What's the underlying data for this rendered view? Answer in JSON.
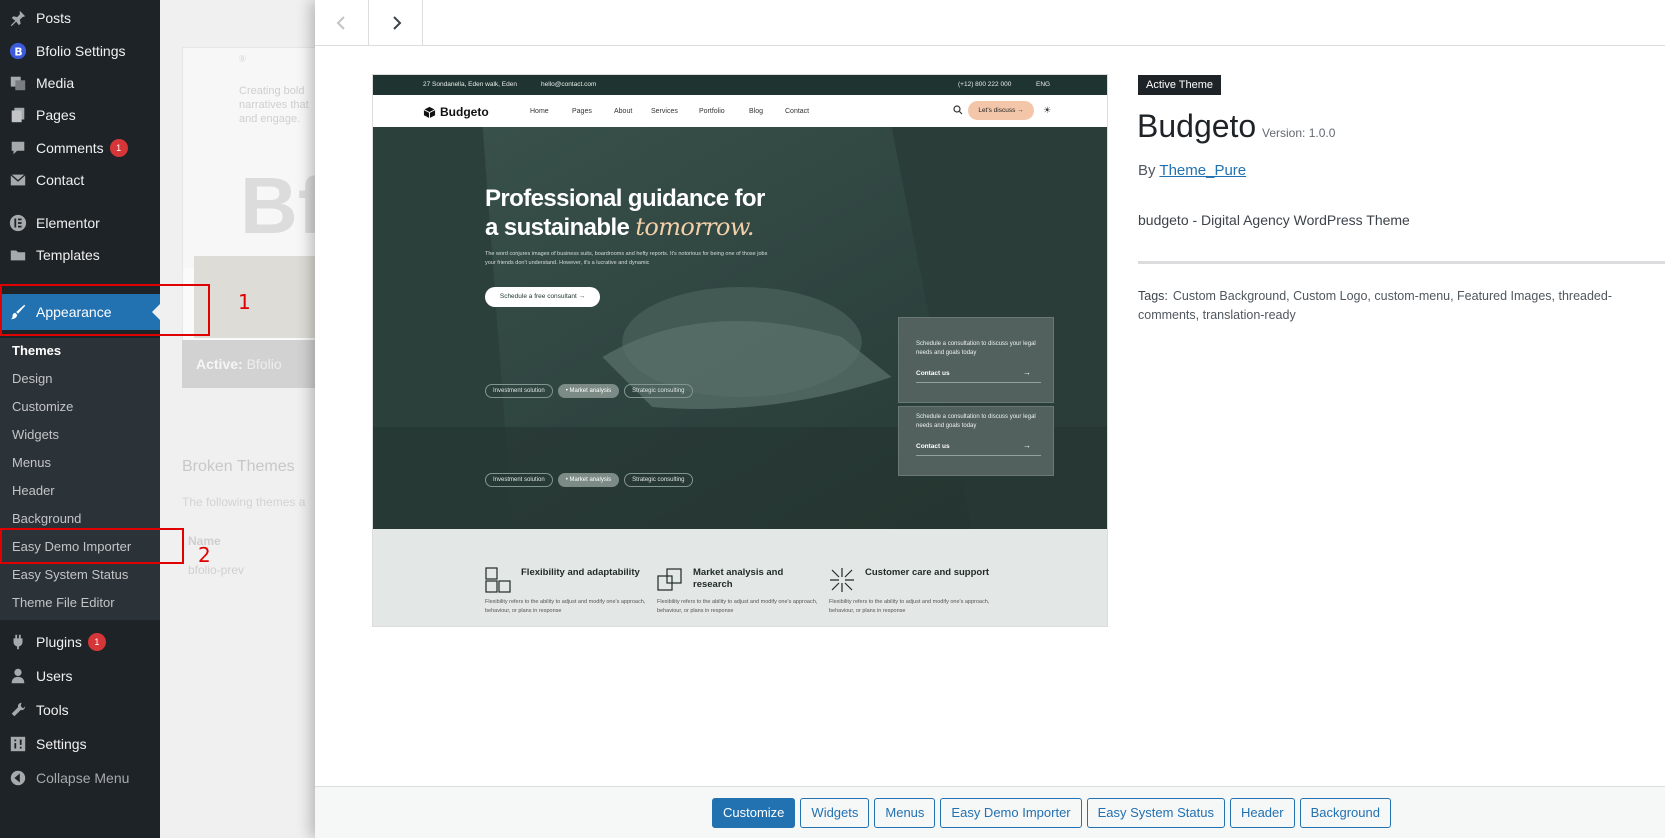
{
  "sidebar": {
    "items": [
      {
        "label": "Posts",
        "icon": "pin-icon"
      },
      {
        "label": "Bfolio Settings",
        "icon": "bfolio-icon"
      },
      {
        "label": "Media",
        "icon": "media-icon"
      },
      {
        "label": "Pages",
        "icon": "pages-icon"
      },
      {
        "label": "Comments",
        "icon": "comment-icon",
        "badge": "1"
      },
      {
        "label": "Contact",
        "icon": "envelope-icon"
      },
      {
        "label": "Elementor",
        "icon": "elementor-icon"
      },
      {
        "label": "Templates",
        "icon": "folder-icon"
      },
      {
        "label": "Appearance",
        "icon": "paintbrush-icon"
      },
      {
        "label": "Plugins",
        "icon": "plugin-icon",
        "badge": "1"
      },
      {
        "label": "Users",
        "icon": "user-icon"
      },
      {
        "label": "Tools",
        "icon": "wrench-icon"
      },
      {
        "label": "Settings",
        "icon": "settings-icon"
      },
      {
        "label": "Collapse Menu",
        "icon": "collapse-icon"
      }
    ],
    "submenu": [
      "Themes",
      "Design",
      "Customize",
      "Widgets",
      "Menus",
      "Header",
      "Background",
      "Easy Demo Importer",
      "Easy System Status",
      "Theme File Editor"
    ],
    "annotations": [
      "1",
      "2"
    ]
  },
  "background": {
    "card_text": "Creating bold narratives that and engage.",
    "big_text": "Bf",
    "active_label": "Active:",
    "active_theme": "Bfolio",
    "broken_title": "Broken Themes",
    "broken_desc": "The following themes a",
    "name_col": "Name",
    "broken_item": "bfolio-prev"
  },
  "screenshot": {
    "topbar": {
      "address": "27 Sondanella, Eden walk, Eden",
      "email": "hello@contact.com",
      "phone": "(+12) 800 222 000",
      "lang": "ENG"
    },
    "logo": "Budgeto",
    "nav": [
      "Home",
      "Pages",
      "About",
      "Services",
      "Portfolio",
      "Blog",
      "Contact"
    ],
    "discuss": "Let's discuss →",
    "headline_1": "Professional guidance for",
    "headline_2a": "a sustainable",
    "headline_2b": "tomorrow.",
    "hero_desc": "The word conjures images of business suits, boardrooms and hefty reports. It's notorious for being one of those jobs your friends don't understand. However, it's a lucrative and dynamic",
    "cta": "Schedule a free consultant →",
    "tags": [
      "Investment solution",
      "• Market analysis",
      "Strategic consulting"
    ],
    "card_text": "Schedule a consultation to discuss your legal needs and goals today",
    "card_link": "Contact us",
    "card_arrow": "→",
    "features": [
      {
        "title": "Flexibility and adaptability",
        "text": "Flexibility refers to the ability to adjust and modify one's approach, behaviour, or plans in response"
      },
      {
        "title": "Market analysis and research",
        "text": "Flexibility refers to the ability to adjust and modify one's approach, behaviour, or plans in response"
      },
      {
        "title": "Customer care and support",
        "text": "Flexibility refers to the ability to adjust and modify one's approach, behaviour, or plans in response"
      }
    ]
  },
  "theme": {
    "badge": "Active Theme",
    "name": "Budgeto",
    "version": "Version: 1.0.0",
    "by": "By",
    "author": "Theme_Pure",
    "description": "budgeto - Digital Agency WordPress Theme",
    "tags_label": "Tags:",
    "tags": "Custom Background, Custom Logo, custom-menu, Featured Images, threaded-comments, translation-ready"
  },
  "footer": {
    "buttons": [
      "Customize",
      "Widgets",
      "Menus",
      "Easy Demo Importer",
      "Easy System Status",
      "Header",
      "Background"
    ]
  },
  "colors": {
    "admin_bar": "#1d2327",
    "accent": "#2271b1",
    "annotation": "#e00000",
    "hero": "#2f4641"
  }
}
